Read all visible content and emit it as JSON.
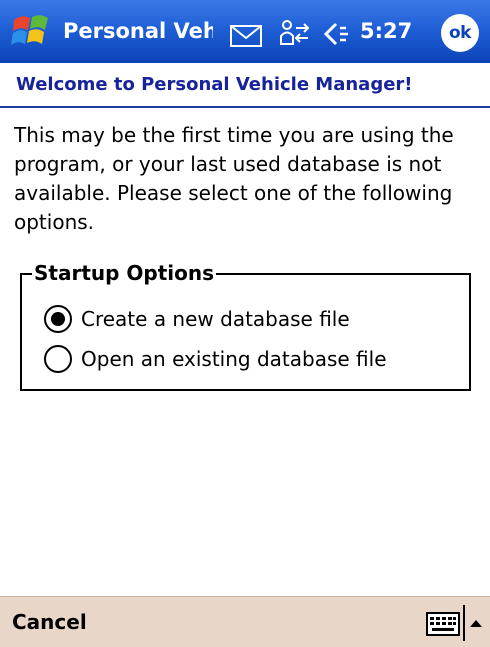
{
  "titlebar": {
    "title": "Personal Vehicle Manager",
    "time": "5:27",
    "ok_label": "ok",
    "icons": [
      "windows-start-icon",
      "envelope-icon",
      "connectivity-icon",
      "volume-icon"
    ]
  },
  "header": {
    "welcome": "Welcome to Personal Vehicle Manager!"
  },
  "body": {
    "intro": "This may be the first time you are using the program, or your last used database is not available. Please select one of the following options.",
    "group_label": "Startup Options",
    "options": [
      {
        "label": "Create a new database file",
        "selected": true
      },
      {
        "label": "Open an existing database file",
        "selected": false
      }
    ]
  },
  "menubar": {
    "cancel_label": "Cancel",
    "icons": [
      "keyboard-icon",
      "chevron-up-icon"
    ]
  },
  "colors": {
    "titlebar_top": "#3b78e7",
    "titlebar_bottom": "#0c44b8",
    "header_text": "#17239a",
    "menubar_bg": "#e8d6c8"
  }
}
